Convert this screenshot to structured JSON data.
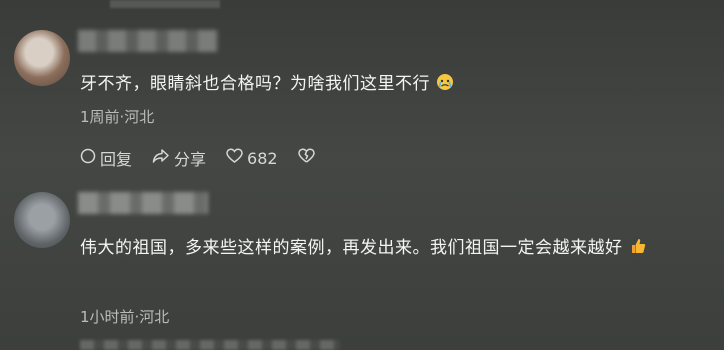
{
  "comments": [
    {
      "text": "牙不齐，眼睛斜也合格吗？为啥我们这里不行",
      "emoji": "crying-face-emoji",
      "meta": "1周前·河北",
      "actions": {
        "reply_label": "回复",
        "share_label": "分享",
        "like_count": "682"
      }
    },
    {
      "text": "伟大的祖国，多来些这样的案例，再发出来。我们祖国一定会越来越好",
      "emoji": "thumbs-up-emoji",
      "meta": "1小时前·河北"
    }
  ],
  "colors": {
    "background": "#424542",
    "text": "#f4f4f4",
    "meta_text": "#b9bcb9"
  }
}
